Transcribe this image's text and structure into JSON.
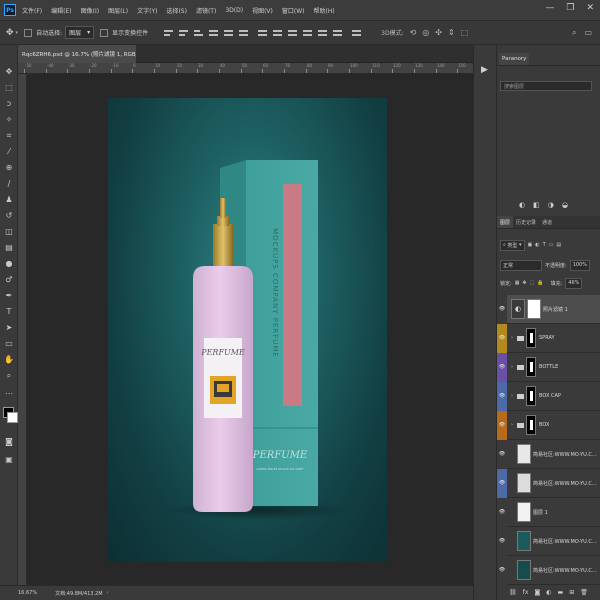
{
  "menubar": {
    "logo": "Ps",
    "items": [
      "文件(F)",
      "编辑(E)",
      "图像(I)",
      "图层(L)",
      "文字(Y)",
      "选择(S)",
      "滤镜(T)",
      "3D(D)",
      "视图(V)",
      "窗口(W)",
      "帮助(H)"
    ],
    "window_controls": [
      "—",
      "❐",
      "✕"
    ]
  },
  "options_bar": {
    "auto_select_label": "自动选择:",
    "auto_select_value": "图层",
    "transform_label": "显示变换控件"
  },
  "document": {
    "tab_label": "Rqc6ZRH6.psd @ 16.7% (照片滤镜 1, RGB/8) *",
    "tab_close": "×",
    "label_brand": "PERFUME",
    "box_side_text": "MOCKUPS COMPANY PERFUME",
    "box_bottom_text": "PERFUME",
    "box_bottom_sub": "LOREM IPSUM DOLOR SIT AMET"
  },
  "ruler": {
    "top_numbers": [
      "-50",
      "-40",
      "-30",
      "-20",
      "-10",
      "0",
      "10",
      "20",
      "30",
      "40",
      "50",
      "60",
      "70",
      "80",
      "90",
      "100",
      "110",
      "120",
      "130",
      "140",
      "150"
    ]
  },
  "statusbar": {
    "zoom": "16.67%",
    "doc_info": "文档:49.8M/413.2M"
  },
  "properties": {
    "tab": "Paranory",
    "search_placeholder": "搜索图层"
  },
  "layers_panel": {
    "tabs": [
      "图层",
      "历史记录",
      "通道"
    ],
    "kind_label": "类型",
    "blend_mode": "正常",
    "opacity_label": "不透明度:",
    "opacity_value": "100%",
    "lock_label": "锁定:",
    "fill_label": "填充:",
    "fill_value": "46%",
    "layers": [
      {
        "name": "照片滤镜 1",
        "tag_color": "#3a3a3a",
        "kind": "adjustment",
        "thumb": "#ffffff"
      },
      {
        "name": "SPRAY",
        "tag_color": "#b38b1d",
        "kind": "group",
        "thumb": "#000000"
      },
      {
        "name": "BOTTLE",
        "tag_color": "#6a4fa6",
        "kind": "group",
        "thumb": "#000000"
      },
      {
        "name": "BOX CAP",
        "tag_color": "#4c6aa8",
        "kind": "group",
        "thumb": "#000000"
      },
      {
        "name": "BOX",
        "tag_color": "#b86a1a",
        "kind": "group",
        "thumb": "#000000"
      },
      {
        "name": "简易社区:WWW.MO-YU.C...",
        "tag_color": "#3a3a3a",
        "kind": "layer",
        "thumb": "#e8e8e8"
      },
      {
        "name": "简易社区:WWW.MO-YU.C...",
        "tag_color": "#4c6aa8",
        "kind": "layer",
        "thumb": "#dcdcdc"
      },
      {
        "name": "图层 1",
        "tag_color": "#3a3a3a",
        "kind": "layer",
        "thumb": "#f2f2f2"
      },
      {
        "name": "简易社区:WWW.MO-YU.C...",
        "tag_color": "#3a3a3a",
        "kind": "layer",
        "thumb": "#1d5a5c"
      },
      {
        "name": "简易社区:WWW.MO-YU.C...",
        "tag_color": "#3a3a3a",
        "kind": "layer",
        "thumb": "#174c4f"
      }
    ]
  }
}
